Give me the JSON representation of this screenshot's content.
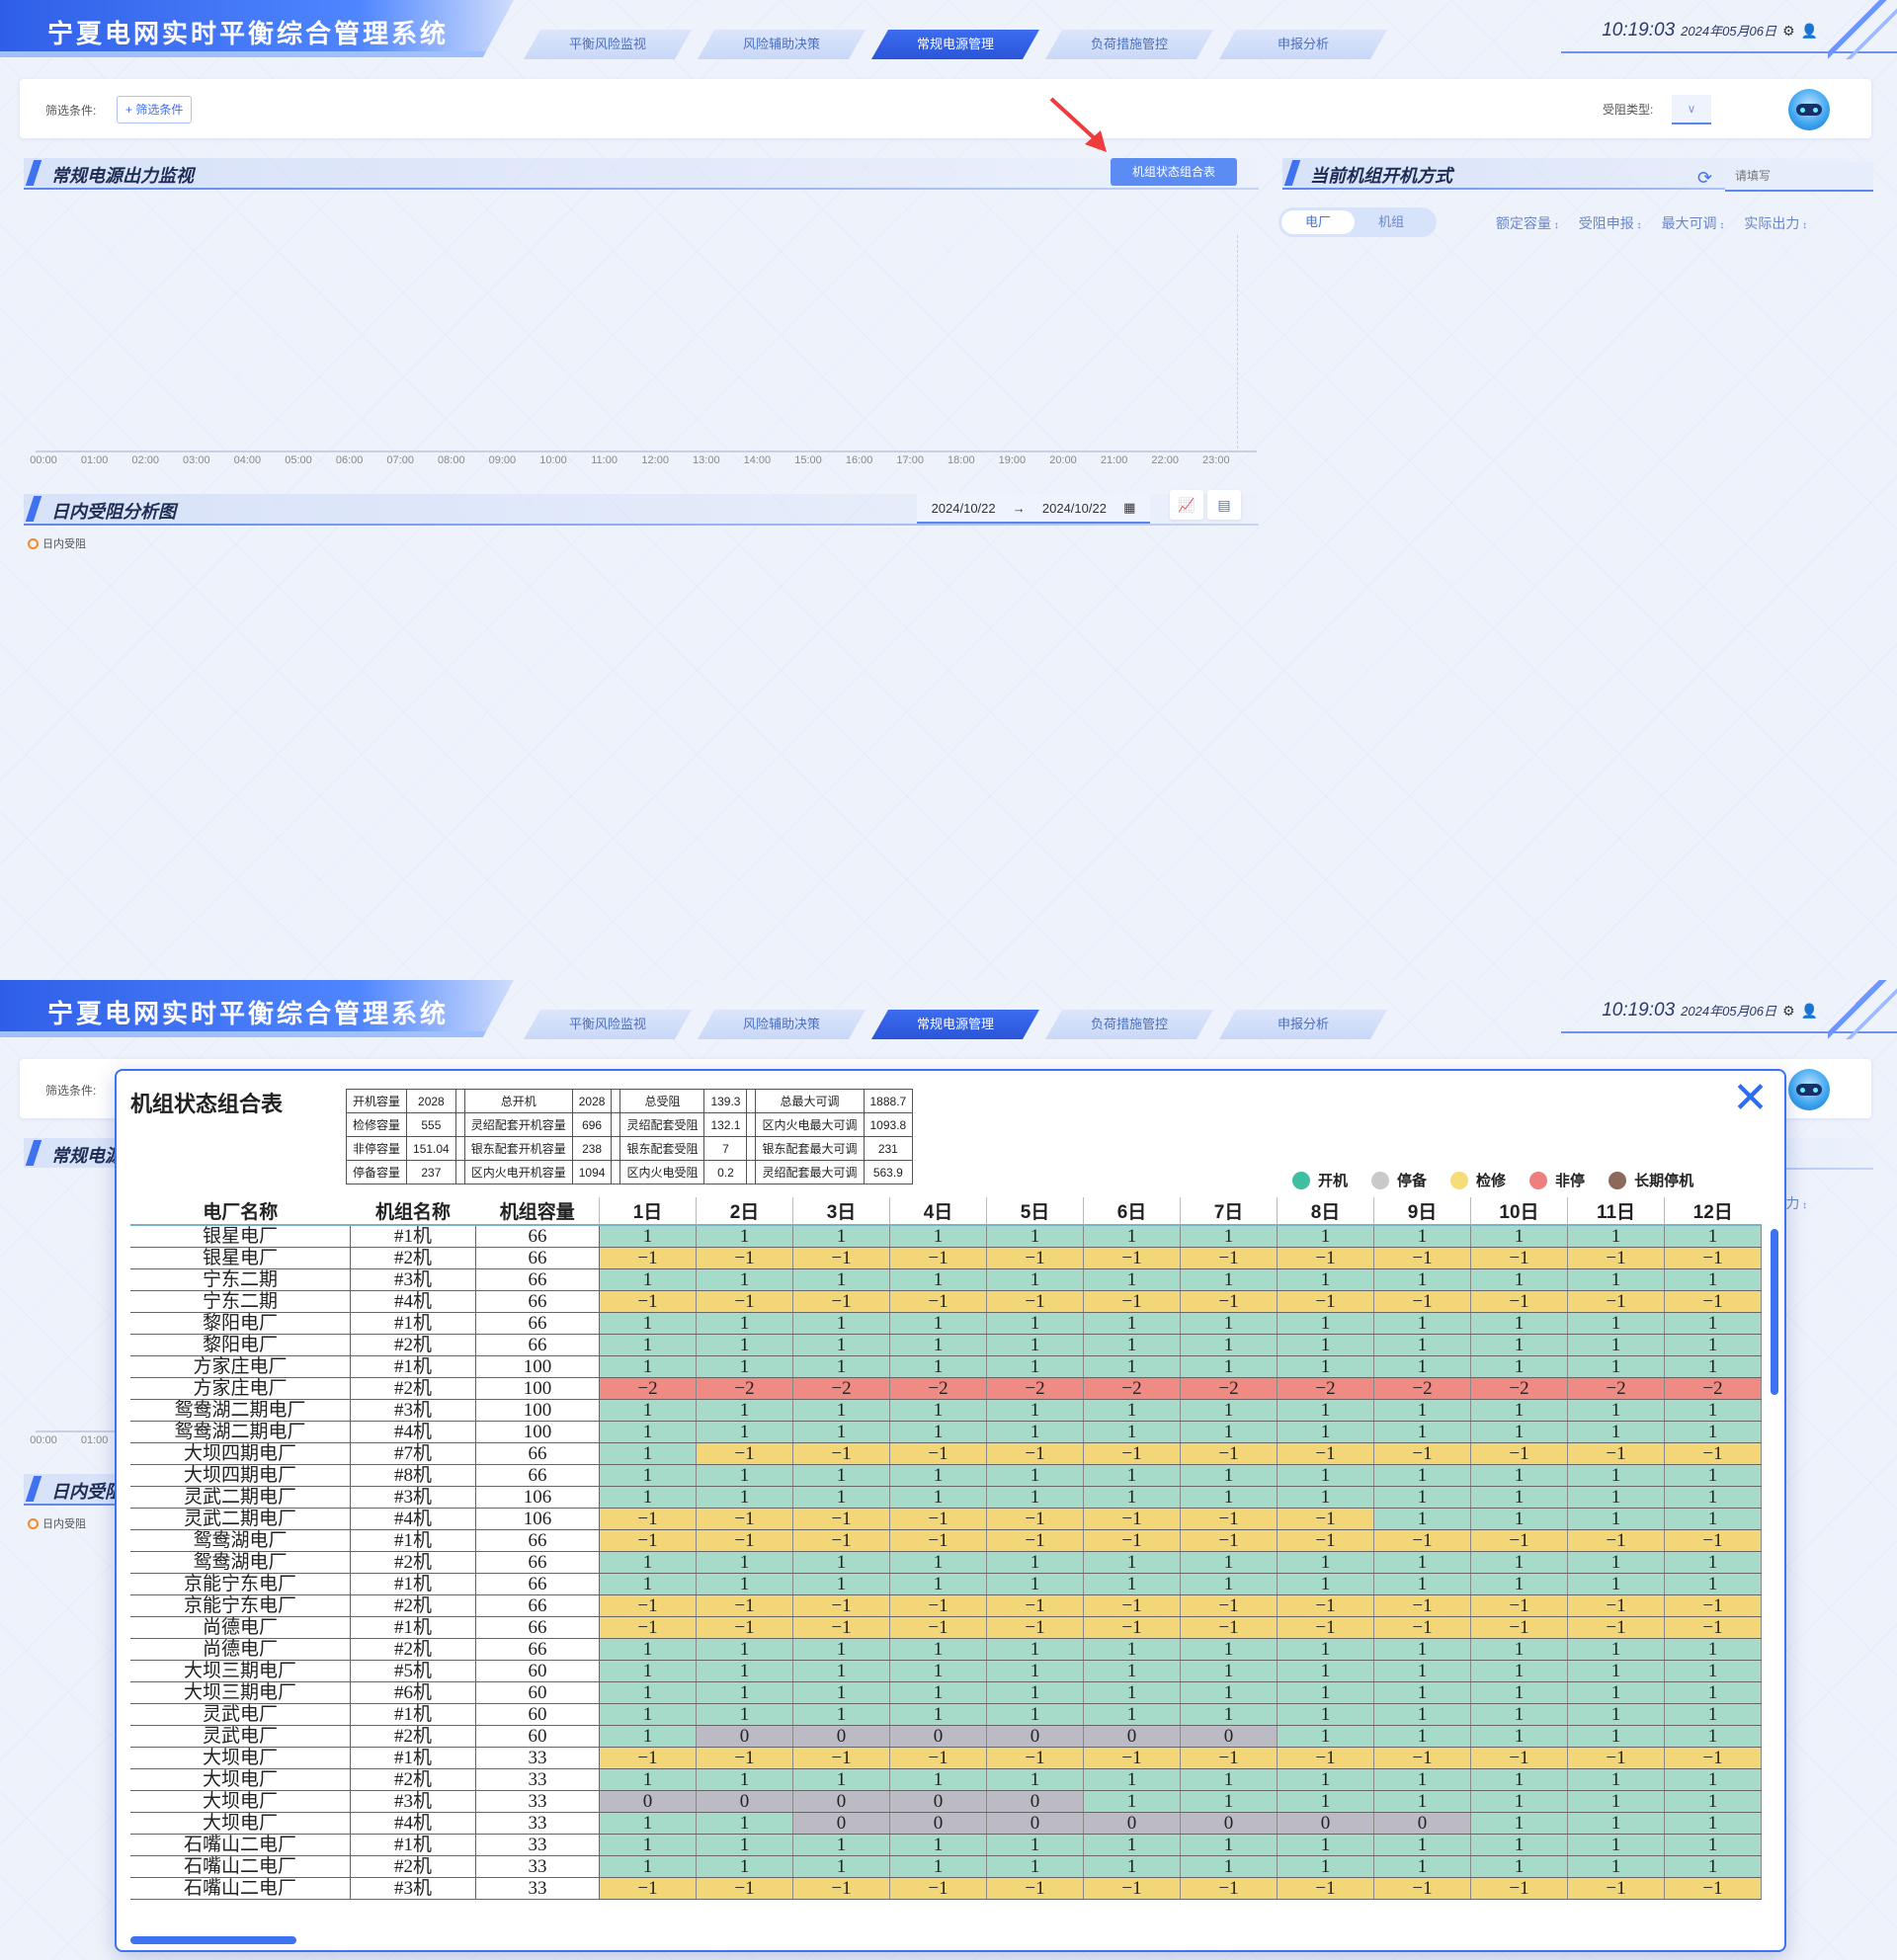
{
  "app_title": "宁夏电网实时平衡综合管理系统",
  "nav_tabs": [
    {
      "label": "平衡风险监视",
      "active": false
    },
    {
      "label": "风险辅助决策",
      "active": false
    },
    {
      "label": "常规电源管理",
      "active": true
    },
    {
      "label": "负荷措施管控",
      "active": false
    },
    {
      "label": "申报分析",
      "active": false
    }
  ],
  "clock": {
    "time": "10:19:03",
    "date": "2024年05月06日"
  },
  "filter": {
    "label": "筛选条件:",
    "button": "+ 筛选条件",
    "type_label": "受阻类型:",
    "type_value": "∨"
  },
  "output_monitor": {
    "title": "常规电源出力监视",
    "combo_button": "机组状态组合表",
    "x_ticks": [
      "00:00",
      "01:00",
      "02:00",
      "03:00",
      "04:00",
      "05:00",
      "06:00",
      "07:00",
      "08:00",
      "09:00",
      "10:00",
      "11:00",
      "12:00",
      "13:00",
      "14:00",
      "15:00",
      "16:00",
      "17:00",
      "18:00",
      "19:00",
      "20:00",
      "21:00",
      "22:00",
      "23:00"
    ]
  },
  "daily_analysis": {
    "title": "日内受阻分析图",
    "date_start": "2024/10/22",
    "date_sep": "→",
    "date_end": "2024/10/22",
    "legend": "日内受阻"
  },
  "current_mode": {
    "title": "当前机组开机方式",
    "search_placeholder": "请填写",
    "segments": [
      "电厂",
      "机组"
    ],
    "sort_columns": [
      "额定容量",
      "受阻申报",
      "最大可调",
      "实际出力"
    ]
  },
  "modal": {
    "title": "机组状态组合表",
    "stats": [
      [
        [
          "开机容量",
          "2028"
        ],
        [
          "总开机",
          "2028"
        ],
        [
          "总受阻",
          "139.3"
        ],
        [
          "总最大可调",
          "1888.7"
        ]
      ],
      [
        [
          "检修容量",
          "555"
        ],
        [
          "灵绍配套开机容量",
          "696"
        ],
        [
          "灵绍配套受阻",
          "132.1"
        ],
        [
          "区内火电最大可调",
          "1093.8"
        ]
      ],
      [
        [
          "非停容量",
          "151.04"
        ],
        [
          "银东配套开机容量",
          "238"
        ],
        [
          "银东配套受阻",
          "7"
        ],
        [
          "银东配套最大可调",
          "231"
        ]
      ],
      [
        [
          "停备容量",
          "237"
        ],
        [
          "区内火电开机容量",
          "1094"
        ],
        [
          "区内火电受阻",
          "0.2"
        ],
        [
          "灵绍配套最大可调",
          "563.9"
        ]
      ]
    ],
    "legend": [
      {
        "label": "开机",
        "color": "#3fbfa0"
      },
      {
        "label": "停备",
        "color": "#c9c9c9"
      },
      {
        "label": "检修",
        "color": "#f7dc7a"
      },
      {
        "label": "非停",
        "color": "#f07e7e"
      },
      {
        "label": "长期停机",
        "color": "#8b6a5c"
      }
    ],
    "status_colors": {
      "1": "#a5dbc8",
      "0": "#bcbac4",
      "-1": "#f3d677",
      "-2": "#f08b84"
    },
    "headers": [
      "电厂名称",
      "机组名称",
      "机组容量",
      "1日",
      "2日",
      "3日",
      "4日",
      "5日",
      "6日",
      "7日",
      "8日",
      "9日",
      "10日",
      "11日",
      "12日"
    ],
    "rows": [
      {
        "plant": "银星电厂",
        "unit": "#1机",
        "cap": "66",
        "days": [
          1,
          1,
          1,
          1,
          1,
          1,
          1,
          1,
          1,
          1,
          1,
          1
        ]
      },
      {
        "plant": "银星电厂",
        "unit": "#2机",
        "cap": "66",
        "days": [
          -1,
          -1,
          -1,
          -1,
          -1,
          -1,
          -1,
          -1,
          -1,
          -1,
          -1,
          -1
        ]
      },
      {
        "plant": "宁东二期",
        "unit": "#3机",
        "cap": "66",
        "days": [
          1,
          1,
          1,
          1,
          1,
          1,
          1,
          1,
          1,
          1,
          1,
          1
        ]
      },
      {
        "plant": "宁东二期",
        "unit": "#4机",
        "cap": "66",
        "days": [
          -1,
          -1,
          -1,
          -1,
          -1,
          -1,
          -1,
          -1,
          -1,
          -1,
          -1,
          -1
        ]
      },
      {
        "plant": "黎阳电厂",
        "unit": "#1机",
        "cap": "66",
        "days": [
          1,
          1,
          1,
          1,
          1,
          1,
          1,
          1,
          1,
          1,
          1,
          1
        ]
      },
      {
        "plant": "黎阳电厂",
        "unit": "#2机",
        "cap": "66",
        "days": [
          1,
          1,
          1,
          1,
          1,
          1,
          1,
          1,
          1,
          1,
          1,
          1
        ]
      },
      {
        "plant": "方家庄电厂",
        "unit": "#1机",
        "cap": "100",
        "days": [
          1,
          1,
          1,
          1,
          1,
          1,
          1,
          1,
          1,
          1,
          1,
          1
        ]
      },
      {
        "plant": "方家庄电厂",
        "unit": "#2机",
        "cap": "100",
        "days": [
          -2,
          -2,
          -2,
          -2,
          -2,
          -2,
          -2,
          -2,
          -2,
          -2,
          -2,
          -2
        ]
      },
      {
        "plant": "鸳鸯湖二期电厂",
        "unit": "#3机",
        "cap": "100",
        "days": [
          1,
          1,
          1,
          1,
          1,
          1,
          1,
          1,
          1,
          1,
          1,
          1
        ]
      },
      {
        "plant": "鸳鸯湖二期电厂",
        "unit": "#4机",
        "cap": "100",
        "days": [
          1,
          1,
          1,
          1,
          1,
          1,
          1,
          1,
          1,
          1,
          1,
          1
        ]
      },
      {
        "plant": "大坝四期电厂",
        "unit": "#7机",
        "cap": "66",
        "days": [
          1,
          -1,
          -1,
          -1,
          -1,
          -1,
          -1,
          -1,
          -1,
          -1,
          -1,
          -1
        ]
      },
      {
        "plant": "大坝四期电厂",
        "unit": "#8机",
        "cap": "66",
        "days": [
          1,
          1,
          1,
          1,
          1,
          1,
          1,
          1,
          1,
          1,
          1,
          1
        ]
      },
      {
        "plant": "灵武二期电厂",
        "unit": "#3机",
        "cap": "106",
        "days": [
          1,
          1,
          1,
          1,
          1,
          1,
          1,
          1,
          1,
          1,
          1,
          1
        ]
      },
      {
        "plant": "灵武二期电厂",
        "unit": "#4机",
        "cap": "106",
        "days": [
          -1,
          -1,
          -1,
          -1,
          -1,
          -1,
          -1,
          -1,
          1,
          1,
          1,
          1
        ]
      },
      {
        "plant": "鸳鸯湖电厂",
        "unit": "#1机",
        "cap": "66",
        "days": [
          -1,
          -1,
          -1,
          -1,
          -1,
          -1,
          -1,
          -1,
          -1,
          -1,
          -1,
          -1
        ]
      },
      {
        "plant": "鸳鸯湖电厂",
        "unit": "#2机",
        "cap": "66",
        "days": [
          1,
          1,
          1,
          1,
          1,
          1,
          1,
          1,
          1,
          1,
          1,
          1
        ]
      },
      {
        "plant": "京能宁东电厂",
        "unit": "#1机",
        "cap": "66",
        "days": [
          1,
          1,
          1,
          1,
          1,
          1,
          1,
          1,
          1,
          1,
          1,
          1
        ]
      },
      {
        "plant": "京能宁东电厂",
        "unit": "#2机",
        "cap": "66",
        "days": [
          -1,
          -1,
          -1,
          -1,
          -1,
          -1,
          -1,
          -1,
          -1,
          -1,
          -1,
          -1
        ]
      },
      {
        "plant": "尚德电厂",
        "unit": "#1机",
        "cap": "66",
        "days": [
          -1,
          -1,
          -1,
          -1,
          -1,
          -1,
          -1,
          -1,
          -1,
          -1,
          -1,
          -1
        ]
      },
      {
        "plant": "尚德电厂",
        "unit": "#2机",
        "cap": "66",
        "days": [
          1,
          1,
          1,
          1,
          1,
          1,
          1,
          1,
          1,
          1,
          1,
          1
        ]
      },
      {
        "plant": "大坝三期电厂",
        "unit": "#5机",
        "cap": "60",
        "days": [
          1,
          1,
          1,
          1,
          1,
          1,
          1,
          1,
          1,
          1,
          1,
          1
        ]
      },
      {
        "plant": "大坝三期电厂",
        "unit": "#6机",
        "cap": "60",
        "days": [
          1,
          1,
          1,
          1,
          1,
          1,
          1,
          1,
          1,
          1,
          1,
          1
        ]
      },
      {
        "plant": "灵武电厂",
        "unit": "#1机",
        "cap": "60",
        "days": [
          1,
          1,
          1,
          1,
          1,
          1,
          1,
          1,
          1,
          1,
          1,
          1
        ]
      },
      {
        "plant": "灵武电厂",
        "unit": "#2机",
        "cap": "60",
        "days": [
          1,
          0,
          0,
          0,
          0,
          0,
          0,
          1,
          1,
          1,
          1,
          1
        ]
      },
      {
        "plant": "大坝电厂",
        "unit": "#1机",
        "cap": "33",
        "days": [
          -1,
          -1,
          -1,
          -1,
          -1,
          -1,
          -1,
          -1,
          -1,
          -1,
          -1,
          -1
        ]
      },
      {
        "plant": "大坝电厂",
        "unit": "#2机",
        "cap": "33",
        "days": [
          1,
          1,
          1,
          1,
          1,
          1,
          1,
          1,
          1,
          1,
          1,
          1
        ]
      },
      {
        "plant": "大坝电厂",
        "unit": "#3机",
        "cap": "33",
        "days": [
          0,
          0,
          0,
          0,
          0,
          1,
          1,
          1,
          1,
          1,
          1,
          1
        ]
      },
      {
        "plant": "大坝电厂",
        "unit": "#4机",
        "cap": "33",
        "days": [
          1,
          1,
          0,
          0,
          0,
          0,
          0,
          0,
          0,
          1,
          1,
          1
        ]
      },
      {
        "plant": "石嘴山二电厂",
        "unit": "#1机",
        "cap": "33",
        "days": [
          1,
          1,
          1,
          1,
          1,
          1,
          1,
          1,
          1,
          1,
          1,
          1
        ]
      },
      {
        "plant": "石嘴山二电厂",
        "unit": "#2机",
        "cap": "33",
        "days": [
          1,
          1,
          1,
          1,
          1,
          1,
          1,
          1,
          1,
          1,
          1,
          1
        ]
      },
      {
        "plant": "石嘴山二电厂",
        "unit": "#3机",
        "cap": "33",
        "days": [
          -1,
          -1,
          -1,
          -1,
          -1,
          -1,
          -1,
          -1,
          -1,
          -1,
          -1,
          -1
        ]
      }
    ]
  }
}
